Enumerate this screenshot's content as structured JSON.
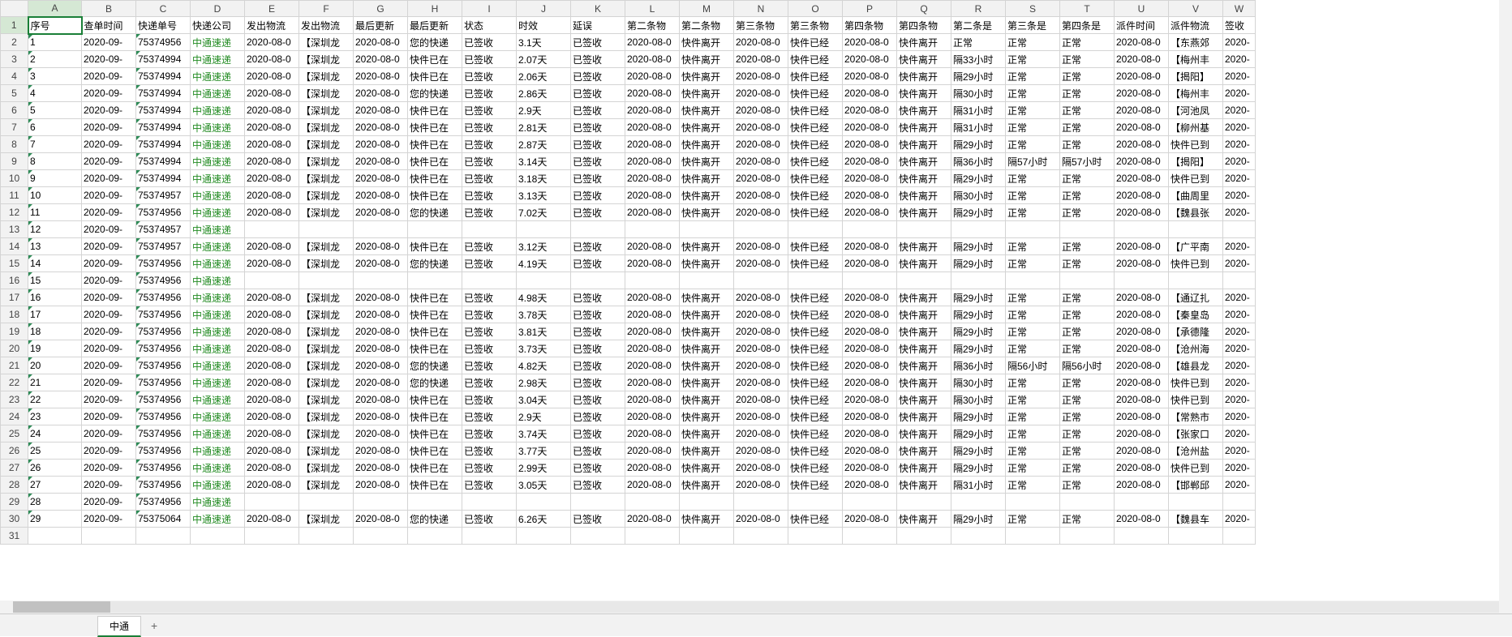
{
  "columns": [
    "A",
    "B",
    "C",
    "D",
    "E",
    "F",
    "G",
    "H",
    "I",
    "J",
    "K",
    "L",
    "M",
    "N",
    "O",
    "P",
    "Q",
    "R",
    "S",
    "T",
    "U",
    "V",
    "W"
  ],
  "headers": [
    "序号",
    "查单时间",
    "快递单号",
    "快递公司",
    "发出物流",
    "发出物流",
    "最后更新",
    "最后更新",
    "状态",
    "时效",
    "延误",
    "第二条物",
    "第二条物",
    "第三条物",
    "第三条物",
    "第四条物",
    "第四条物",
    "第二条是",
    "第三条是",
    "第四条是",
    "派件时间",
    "派件物流",
    "签收"
  ],
  "active_cell": "A1",
  "sheet_tab": "中通",
  "rows": [
    {
      "n": "1",
      "b": "2020-09-",
      "c": "75374956",
      "d": "中通速递",
      "e": "2020-08-0",
      "f": "【深圳龙",
      "g": "2020-08-0",
      "h": "您的快递",
      "i": "已签收",
      "j": "3.1天",
      "k": "已签收",
      "l": "2020-08-0",
      "m": "快件离开",
      "n2": "2020-08-0",
      "o": "快件已经",
      "p": "2020-08-0",
      "q": "快件离开",
      "r": "正常",
      "s": "正常",
      "t": "正常",
      "u": "2020-08-0",
      "v": "【东燕郊",
      "w": "2020-"
    },
    {
      "n": "2",
      "b": "2020-09-",
      "c": "75374994",
      "d": "中通速递",
      "e": "2020-08-0",
      "f": "【深圳龙",
      "g": "2020-08-0",
      "h": "快件已在",
      "i": "已签收",
      "j": "2.07天",
      "k": "已签收",
      "l": "2020-08-0",
      "m": "快件离开",
      "n2": "2020-08-0",
      "o": "快件已经",
      "p": "2020-08-0",
      "q": "快件离开",
      "r": "隔33小时",
      "s": "正常",
      "t": "正常",
      "u": "2020-08-0",
      "v": "【梅州丰",
      "w": "2020-"
    },
    {
      "n": "3",
      "b": "2020-09-",
      "c": "75374994",
      "d": "中通速递",
      "e": "2020-08-0",
      "f": "【深圳龙",
      "g": "2020-08-0",
      "h": "快件已在",
      "i": "已签收",
      "j": "2.06天",
      "k": "已签收",
      "l": "2020-08-0",
      "m": "快件离开",
      "n2": "2020-08-0",
      "o": "快件已经",
      "p": "2020-08-0",
      "q": "快件离开",
      "r": "隔29小时",
      "s": "正常",
      "t": "正常",
      "u": "2020-08-0",
      "v": "【揭阳】",
      "w": "2020-"
    },
    {
      "n": "4",
      "b": "2020-09-",
      "c": "75374994",
      "d": "中通速递",
      "e": "2020-08-0",
      "f": "【深圳龙",
      "g": "2020-08-0",
      "h": "您的快递",
      "i": "已签收",
      "j": "2.86天",
      "k": "已签收",
      "l": "2020-08-0",
      "m": "快件离开",
      "n2": "2020-08-0",
      "o": "快件已经",
      "p": "2020-08-0",
      "q": "快件离开",
      "r": "隔30小时",
      "s": "正常",
      "t": "正常",
      "u": "2020-08-0",
      "v": "【梅州丰",
      "w": "2020-"
    },
    {
      "n": "5",
      "b": "2020-09-",
      "c": "75374994",
      "d": "中通速递",
      "e": "2020-08-0",
      "f": "【深圳龙",
      "g": "2020-08-0",
      "h": "快件已在",
      "i": "已签收",
      "j": "2.9天",
      "k": "已签收",
      "l": "2020-08-0",
      "m": "快件离开",
      "n2": "2020-08-0",
      "o": "快件已经",
      "p": "2020-08-0",
      "q": "快件离开",
      "r": "隔31小时",
      "s": "正常",
      "t": "正常",
      "u": "2020-08-0",
      "v": "【河池凤",
      "w": "2020-"
    },
    {
      "n": "6",
      "b": "2020-09-",
      "c": "75374994",
      "d": "中通速递",
      "e": "2020-08-0",
      "f": "【深圳龙",
      "g": "2020-08-0",
      "h": "快件已在",
      "i": "已签收",
      "j": "2.81天",
      "k": "已签收",
      "l": "2020-08-0",
      "m": "快件离开",
      "n2": "2020-08-0",
      "o": "快件已经",
      "p": "2020-08-0",
      "q": "快件离开",
      "r": "隔31小时",
      "s": "正常",
      "t": "正常",
      "u": "2020-08-0",
      "v": "【柳州基",
      "w": "2020-"
    },
    {
      "n": "7",
      "b": "2020-09-",
      "c": "75374994",
      "d": "中通速递",
      "e": "2020-08-0",
      "f": "【深圳龙",
      "g": "2020-08-0",
      "h": "快件已在",
      "i": "已签收",
      "j": "2.87天",
      "k": "已签收",
      "l": "2020-08-0",
      "m": "快件离开",
      "n2": "2020-08-0",
      "o": "快件已经",
      "p": "2020-08-0",
      "q": "快件离开",
      "r": "隔29小时",
      "s": "正常",
      "t": "正常",
      "u": "2020-08-0",
      "v": "快件已到",
      "w": "2020-"
    },
    {
      "n": "8",
      "b": "2020-09-",
      "c": "75374994",
      "d": "中通速递",
      "e": "2020-08-0",
      "f": "【深圳龙",
      "g": "2020-08-0",
      "h": "快件已在",
      "i": "已签收",
      "j": "3.14天",
      "k": "已签收",
      "l": "2020-08-0",
      "m": "快件离开",
      "n2": "2020-08-0",
      "o": "快件已经",
      "p": "2020-08-0",
      "q": "快件离开",
      "r": "隔36小时",
      "s": "隔57小时",
      "t": "隔57小时",
      "u": "2020-08-0",
      "v": "【揭阳】",
      "w": "2020-"
    },
    {
      "n": "9",
      "b": "2020-09-",
      "c": "75374994",
      "d": "中通速递",
      "e": "2020-08-0",
      "f": "【深圳龙",
      "g": "2020-08-0",
      "h": "快件已在",
      "i": "已签收",
      "j": "3.18天",
      "k": "已签收",
      "l": "2020-08-0",
      "m": "快件离开",
      "n2": "2020-08-0",
      "o": "快件已经",
      "p": "2020-08-0",
      "q": "快件离开",
      "r": "隔29小时",
      "s": "正常",
      "t": "正常",
      "u": "2020-08-0",
      "v": "快件已到",
      "w": "2020-"
    },
    {
      "n": "10",
      "b": "2020-09-",
      "c": "75374957",
      "d": "中通速递",
      "e": "2020-08-0",
      "f": "【深圳龙",
      "g": "2020-08-0",
      "h": "快件已在",
      "i": "已签收",
      "j": "3.13天",
      "k": "已签收",
      "l": "2020-08-0",
      "m": "快件离开",
      "n2": "2020-08-0",
      "o": "快件已经",
      "p": "2020-08-0",
      "q": "快件离开",
      "r": "隔30小时",
      "s": "正常",
      "t": "正常",
      "u": "2020-08-0",
      "v": "【曲周里",
      "w": "2020-"
    },
    {
      "n": "11",
      "b": "2020-09-",
      "c": "75374956",
      "d": "中通速递",
      "e": "2020-08-0",
      "f": "【深圳龙",
      "g": "2020-08-0",
      "h": "您的快递",
      "i": "已签收",
      "j": "7.02天",
      "k": "已签收",
      "l": "2020-08-0",
      "m": "快件离开",
      "n2": "2020-08-0",
      "o": "快件已经",
      "p": "2020-08-0",
      "q": "快件离开",
      "r": "隔29小时",
      "s": "正常",
      "t": "正常",
      "u": "2020-08-0",
      "v": "【魏县张",
      "w": "2020-"
    },
    {
      "n": "12",
      "b": "2020-09-",
      "c": "75374957",
      "d": "中通速递"
    },
    {
      "n": "13",
      "b": "2020-09-",
      "c": "75374957",
      "d": "中通速递",
      "e": "2020-08-0",
      "f": "【深圳龙",
      "g": "2020-08-0",
      "h": "快件已在",
      "i": "已签收",
      "j": "3.12天",
      "k": "已签收",
      "l": "2020-08-0",
      "m": "快件离开",
      "n2": "2020-08-0",
      "o": "快件已经",
      "p": "2020-08-0",
      "q": "快件离开",
      "r": "隔29小时",
      "s": "正常",
      "t": "正常",
      "u": "2020-08-0",
      "v": "【广平南",
      "w": "2020-"
    },
    {
      "n": "14",
      "b": "2020-09-",
      "c": "75374956",
      "d": "中通速递",
      "e": "2020-08-0",
      "f": "【深圳龙",
      "g": "2020-08-0",
      "h": "您的快递",
      "i": "已签收",
      "j": "4.19天",
      "k": "已签收",
      "l": "2020-08-0",
      "m": "快件离开",
      "n2": "2020-08-0",
      "o": "快件已经",
      "p": "2020-08-0",
      "q": "快件离开",
      "r": "隔29小时",
      "s": "正常",
      "t": "正常",
      "u": "2020-08-0",
      "v": "快件已到",
      "w": "2020-"
    },
    {
      "n": "15",
      "b": "2020-09-",
      "c": "75374956",
      "d": "中通速递"
    },
    {
      "n": "16",
      "b": "2020-09-",
      "c": "75374956",
      "d": "中通速递",
      "e": "2020-08-0",
      "f": "【深圳龙",
      "g": "2020-08-0",
      "h": "快件已在",
      "i": "已签收",
      "j": "4.98天",
      "k": "已签收",
      "l": "2020-08-0",
      "m": "快件离开",
      "n2": "2020-08-0",
      "o": "快件已经",
      "p": "2020-08-0",
      "q": "快件离开",
      "r": "隔29小时",
      "s": "正常",
      "t": "正常",
      "u": "2020-08-0",
      "v": "【通辽扎",
      "w": "2020-"
    },
    {
      "n": "17",
      "b": "2020-09-",
      "c": "75374956",
      "d": "中通速递",
      "e": "2020-08-0",
      "f": "【深圳龙",
      "g": "2020-08-0",
      "h": "快件已在",
      "i": "已签收",
      "j": "3.78天",
      "k": "已签收",
      "l": "2020-08-0",
      "m": "快件离开",
      "n2": "2020-08-0",
      "o": "快件已经",
      "p": "2020-08-0",
      "q": "快件离开",
      "r": "隔29小时",
      "s": "正常",
      "t": "正常",
      "u": "2020-08-0",
      "v": "【秦皇岛",
      "w": "2020-"
    },
    {
      "n": "18",
      "b": "2020-09-",
      "c": "75374956",
      "d": "中通速递",
      "e": "2020-08-0",
      "f": "【深圳龙",
      "g": "2020-08-0",
      "h": "快件已在",
      "i": "已签收",
      "j": "3.81天",
      "k": "已签收",
      "l": "2020-08-0",
      "m": "快件离开",
      "n2": "2020-08-0",
      "o": "快件已经",
      "p": "2020-08-0",
      "q": "快件离开",
      "r": "隔29小时",
      "s": "正常",
      "t": "正常",
      "u": "2020-08-0",
      "v": "【承德隆",
      "w": "2020-"
    },
    {
      "n": "19",
      "b": "2020-09-",
      "c": "75374956",
      "d": "中通速递",
      "e": "2020-08-0",
      "f": "【深圳龙",
      "g": "2020-08-0",
      "h": "快件已在",
      "i": "已签收",
      "j": "3.73天",
      "k": "已签收",
      "l": "2020-08-0",
      "m": "快件离开",
      "n2": "2020-08-0",
      "o": "快件已经",
      "p": "2020-08-0",
      "q": "快件离开",
      "r": "隔29小时",
      "s": "正常",
      "t": "正常",
      "u": "2020-08-0",
      "v": "【沧州海",
      "w": "2020-"
    },
    {
      "n": "20",
      "b": "2020-09-",
      "c": "75374956",
      "d": "中通速递",
      "e": "2020-08-0",
      "f": "【深圳龙",
      "g": "2020-08-0",
      "h": "您的快递",
      "i": "已签收",
      "j": "4.82天",
      "k": "已签收",
      "l": "2020-08-0",
      "m": "快件离开",
      "n2": "2020-08-0",
      "o": "快件已经",
      "p": "2020-08-0",
      "q": "快件离开",
      "r": "隔36小时",
      "s": "隔56小时",
      "t": "隔56小时",
      "u": "2020-08-0",
      "v": "【雄县龙",
      "w": "2020-"
    },
    {
      "n": "21",
      "b": "2020-09-",
      "c": "75374956",
      "d": "中通速递",
      "e": "2020-08-0",
      "f": "【深圳龙",
      "g": "2020-08-0",
      "h": "您的快递",
      "i": "已签收",
      "j": "2.98天",
      "k": "已签收",
      "l": "2020-08-0",
      "m": "快件离开",
      "n2": "2020-08-0",
      "o": "快件已经",
      "p": "2020-08-0",
      "q": "快件离开",
      "r": "隔30小时",
      "s": "正常",
      "t": "正常",
      "u": "2020-08-0",
      "v": "快件已到",
      "w": "2020-"
    },
    {
      "n": "22",
      "b": "2020-09-",
      "c": "75374956",
      "d": "中通速递",
      "e": "2020-08-0",
      "f": "【深圳龙",
      "g": "2020-08-0",
      "h": "快件已在",
      "i": "已签收",
      "j": "3.04天",
      "k": "已签收",
      "l": "2020-08-0",
      "m": "快件离开",
      "n2": "2020-08-0",
      "o": "快件已经",
      "p": "2020-08-0",
      "q": "快件离开",
      "r": "隔30小时",
      "s": "正常",
      "t": "正常",
      "u": "2020-08-0",
      "v": "快件已到",
      "w": "2020-"
    },
    {
      "n": "23",
      "b": "2020-09-",
      "c": "75374956",
      "d": "中通速递",
      "e": "2020-08-0",
      "f": "【深圳龙",
      "g": "2020-08-0",
      "h": "快件已在",
      "i": "已签收",
      "j": "2.9天",
      "k": "已签收",
      "l": "2020-08-0",
      "m": "快件离开",
      "n2": "2020-08-0",
      "o": "快件已经",
      "p": "2020-08-0",
      "q": "快件离开",
      "r": "隔29小时",
      "s": "正常",
      "t": "正常",
      "u": "2020-08-0",
      "v": "【常熟市",
      "w": "2020-"
    },
    {
      "n": "24",
      "b": "2020-09-",
      "c": "75374956",
      "d": "中通速递",
      "e": "2020-08-0",
      "f": "【深圳龙",
      "g": "2020-08-0",
      "h": "快件已在",
      "i": "已签收",
      "j": "3.74天",
      "k": "已签收",
      "l": "2020-08-0",
      "m": "快件离开",
      "n2": "2020-08-0",
      "o": "快件已经",
      "p": "2020-08-0",
      "q": "快件离开",
      "r": "隔29小时",
      "s": "正常",
      "t": "正常",
      "u": "2020-08-0",
      "v": "【张家口",
      "w": "2020-"
    },
    {
      "n": "25",
      "b": "2020-09-",
      "c": "75374956",
      "d": "中通速递",
      "e": "2020-08-0",
      "f": "【深圳龙",
      "g": "2020-08-0",
      "h": "快件已在",
      "i": "已签收",
      "j": "3.77天",
      "k": "已签收",
      "l": "2020-08-0",
      "m": "快件离开",
      "n2": "2020-08-0",
      "o": "快件已经",
      "p": "2020-08-0",
      "q": "快件离开",
      "r": "隔29小时",
      "s": "正常",
      "t": "正常",
      "u": "2020-08-0",
      "v": "【沧州盐",
      "w": "2020-"
    },
    {
      "n": "26",
      "b": "2020-09-",
      "c": "75374956",
      "d": "中通速递",
      "e": "2020-08-0",
      "f": "【深圳龙",
      "g": "2020-08-0",
      "h": "快件已在",
      "i": "已签收",
      "j": "2.99天",
      "k": "已签收",
      "l": "2020-08-0",
      "m": "快件离开",
      "n2": "2020-08-0",
      "o": "快件已经",
      "p": "2020-08-0",
      "q": "快件离开",
      "r": "隔29小时",
      "s": "正常",
      "t": "正常",
      "u": "2020-08-0",
      "v": "快件已到",
      "w": "2020-"
    },
    {
      "n": "27",
      "b": "2020-09-",
      "c": "75374956",
      "d": "中通速递",
      "e": "2020-08-0",
      "f": "【深圳龙",
      "g": "2020-08-0",
      "h": "快件已在",
      "i": "已签收",
      "j": "3.05天",
      "k": "已签收",
      "l": "2020-08-0",
      "m": "快件离开",
      "n2": "2020-08-0",
      "o": "快件已经",
      "p": "2020-08-0",
      "q": "快件离开",
      "r": "隔31小时",
      "s": "正常",
      "t": "正常",
      "u": "2020-08-0",
      "v": "【邯郸邱",
      "w": "2020-"
    },
    {
      "n": "28",
      "b": "2020-09-",
      "c": "75374956",
      "d": "中通速递"
    },
    {
      "n": "29",
      "b": "2020-09-",
      "c": "75375064",
      "d": "中通速递",
      "e": "2020-08-0",
      "f": "【深圳龙",
      "g": "2020-08-0",
      "h": "您的快递",
      "i": "已签收",
      "j": "6.26天",
      "k": "已签收",
      "l": "2020-08-0",
      "m": "快件离开",
      "n2": "2020-08-0",
      "o": "快件已经",
      "p": "2020-08-0",
      "q": "快件离开",
      "r": "隔29小时",
      "s": "正常",
      "t": "正常",
      "u": "2020-08-0",
      "v": "【魏县车",
      "w": "2020-"
    }
  ]
}
